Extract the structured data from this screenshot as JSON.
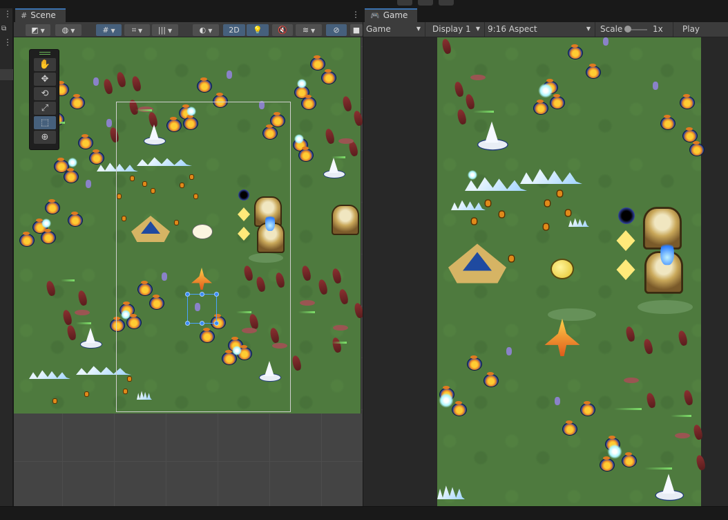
{
  "scene_tab": {
    "title": "Scene"
  },
  "game_tab": {
    "title": "Game"
  },
  "scene_toolbar": {
    "mode_2d": "2D"
  },
  "game_toolbar": {
    "view_mode": "Game",
    "display": "Display 1",
    "aspect": "9:16 Aspect",
    "scale_label": "Scale",
    "scale_value": "1x",
    "play_focused": "Play Focuse"
  },
  "icons": {
    "scene_tab_icon": "grid-icon",
    "game_tab_icon": "gamepad-icon",
    "tools": [
      "hand-icon",
      "move-icon",
      "rotate-icon",
      "scale-icon",
      "rect-transform-icon",
      "transform-icon"
    ]
  },
  "colors": {
    "active_tab_accent": "#3a72b0",
    "active_toggle": "#46607c",
    "grass": "#4e7a3e",
    "selection": "#3b8cf5"
  }
}
